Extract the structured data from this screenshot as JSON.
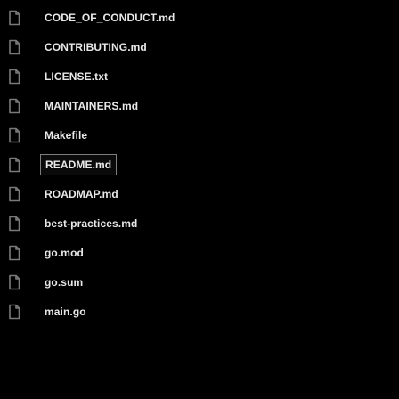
{
  "files": [
    {
      "name": "CODE_OF_CONDUCT.md",
      "icon": "file-icon",
      "selected": false
    },
    {
      "name": "CONTRIBUTING.md",
      "icon": "file-icon",
      "selected": false
    },
    {
      "name": "LICENSE.txt",
      "icon": "file-icon",
      "selected": false
    },
    {
      "name": "MAINTAINERS.md",
      "icon": "file-icon",
      "selected": false
    },
    {
      "name": "Makefile",
      "icon": "file-icon",
      "selected": false
    },
    {
      "name": "README.md",
      "icon": "file-icon",
      "selected": true
    },
    {
      "name": "ROADMAP.md",
      "icon": "file-icon",
      "selected": false
    },
    {
      "name": "best-practices.md",
      "icon": "file-icon",
      "selected": false
    },
    {
      "name": "go.mod",
      "icon": "file-icon",
      "selected": false
    },
    {
      "name": "go.sum",
      "icon": "file-icon",
      "selected": false
    },
    {
      "name": "main.go",
      "icon": "file-icon",
      "selected": false
    }
  ],
  "colors": {
    "background": "#000000",
    "text": "#e8e8e8",
    "icon_stroke": "#7a7a7a",
    "selection_border": "#7e7e7e"
  }
}
